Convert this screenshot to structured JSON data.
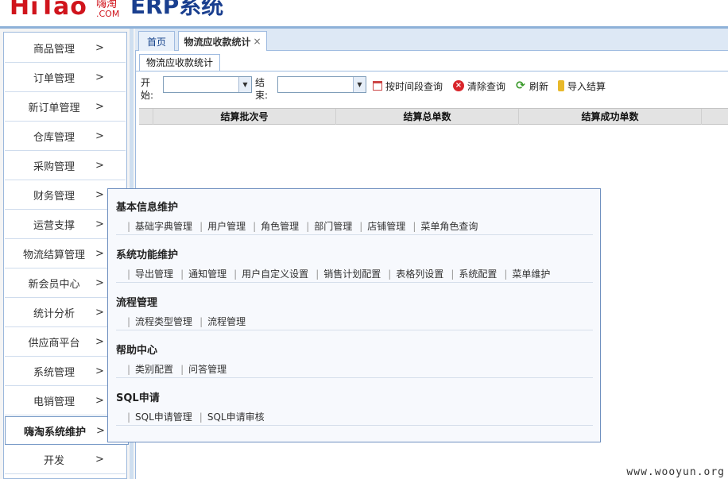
{
  "header": {
    "logo_text": "HiTao",
    "logo_sub_cn": "嗨淘",
    "logo_sub_en": ".COM",
    "erp_title": "ERP系统"
  },
  "sidebar": {
    "items": [
      {
        "label": "商品管理",
        "arrow": ">"
      },
      {
        "label": "订单管理",
        "arrow": ">"
      },
      {
        "label": "新订单管理",
        "arrow": ">"
      },
      {
        "label": "仓库管理",
        "arrow": ">"
      },
      {
        "label": "采购管理",
        "arrow": ">"
      },
      {
        "label": "财务管理",
        "arrow": ">"
      },
      {
        "label": "运营支撑",
        "arrow": ">"
      },
      {
        "label": "物流结算管理",
        "arrow": ">"
      },
      {
        "label": "新会员中心",
        "arrow": ">"
      },
      {
        "label": "统计分析",
        "arrow": ">"
      },
      {
        "label": "供应商平台",
        "arrow": ">"
      },
      {
        "label": "系统管理",
        "arrow": ">"
      },
      {
        "label": "电销管理",
        "arrow": ">"
      },
      {
        "label": "嗨淘系统维护",
        "arrow": ">"
      },
      {
        "label": "开发",
        "arrow": ">"
      }
    ],
    "active_index": 13
  },
  "tabs": [
    {
      "label": "首页",
      "closable": false
    },
    {
      "label": "物流应收款统计",
      "closable": true,
      "close": "×"
    }
  ],
  "subtab": {
    "label": "物流应收款统计"
  },
  "toolbar": {
    "start_label": "开始:",
    "end_label": "结束:",
    "start_value": "",
    "end_value": "",
    "combo_arrow": "▼",
    "query_by_time": "按时间段查询",
    "clear_query": "清除查询",
    "refresh": "刷新",
    "import": "导入结算"
  },
  "grid": {
    "columns": [
      "结算批次号",
      "结算总单数",
      "结算成功单数"
    ]
  },
  "menu": {
    "sections": [
      {
        "title": "基本信息维护",
        "links": [
          "基础字典管理",
          "用户管理",
          "角色管理",
          "部门管理",
          "店铺管理",
          "菜单角色查询"
        ]
      },
      {
        "title": "系统功能维护",
        "links": [
          "导出管理",
          "通知管理",
          "用户自定义设置",
          "销售计划配置",
          "表格列设置",
          "系统配置",
          "菜单维护"
        ]
      },
      {
        "title": "流程管理",
        "links": [
          "流程类型管理",
          "流程管理"
        ]
      },
      {
        "title": "帮助中心",
        "links": [
          "类别配置",
          "问答管理"
        ]
      },
      {
        "title": "SQL申请",
        "links": [
          "SQL申请管理",
          "SQL申请审核"
        ]
      }
    ],
    "separator": "|"
  },
  "watermark": "www.wooyun.org",
  "colors": {
    "logo_red": "#d0141c",
    "erp_blue": "#1a3f8f",
    "border_blue": "#9fbbe0"
  }
}
